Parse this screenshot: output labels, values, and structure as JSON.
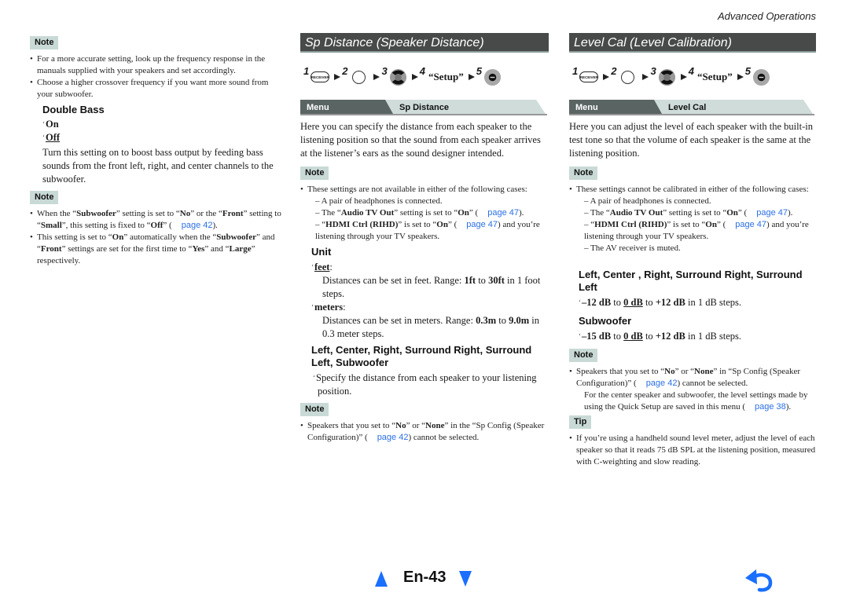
{
  "header": {
    "section": "Advanced Operations"
  },
  "col1": {
    "note1": {
      "label": "Note",
      "items": [
        "For a more accurate setting, look up the frequency response in the manuals supplied with your speakers and set accordingly.",
        "Choose a higher crossover frequency if you want more sound from your subwoofer."
      ]
    },
    "double_bass": {
      "heading": "Double Bass",
      "options": [
        "On",
        "Off"
      ],
      "default_option": "Off",
      "description": "Turn this setting on to boost bass output by feeding bass sounds from the front left, right, and center channels to the subwoofer."
    },
    "note2": {
      "label": "Note",
      "item1": {
        "p1": "When the “",
        "b1": "Subwoofer",
        "p2": "” setting is set to “",
        "b2": "No",
        "p3": "” or the “",
        "b3": "Front",
        "p4": "” setting to “",
        "b4": "Small",
        "p5": "”, this setting is fixed to “",
        "b5": "Off",
        "p6": "” (",
        "link": "page 42",
        "p7": ")."
      },
      "item2": {
        "p1": "This setting is set to “",
        "b1": "On",
        "p2": "” automatically when the “",
        "b2": "Subwoofer",
        "p3": "” and “",
        "b3": "Front",
        "p4": "” settings are set for the first time to “",
        "b4": "Yes",
        "p5": "” and “",
        "b5": "Large",
        "p6": "” respectively."
      }
    }
  },
  "col2": {
    "title": "Sp Distance (Speaker Distance)",
    "steps": {
      "n1": "1",
      "n2": "2",
      "n3": "3",
      "n4": "4",
      "n5": "5",
      "receiver_label": "RECEIVER",
      "setup": "“Setup”"
    },
    "menu": {
      "label": "Menu",
      "item": "Sp Distance"
    },
    "intro": "Here you can specify the distance from each speaker to the listening position so that the sound from each speaker arrives at the listener’s ears as the sound designer intended.",
    "note1": {
      "label": "Note",
      "lead": "These settings are not available in either of the following cases:",
      "sub1": "– A pair of headphones is connected.",
      "sub2": {
        "p1": "– The “",
        "b1": "Audio TV Out",
        "p2": "” setting is set to “",
        "b2": "On",
        "p3": "” (",
        "link": "page 47",
        "p4": ")."
      },
      "sub3": {
        "p1": "– “",
        "b1": "HDMI Ctrl (RIHD)",
        "p2": "” is set to “",
        "b2": "On",
        "p3": "” (",
        "link": "page 47",
        "p4": ") and you’re listening through your TV speakers."
      }
    },
    "unit": {
      "heading": "Unit",
      "feet_label": "feet",
      "feet_desc": {
        "p1": "Distances can be set in feet. Range: ",
        "b1": "1ft",
        "p2": " to ",
        "b2": "30ft",
        "p3": " in 1 foot steps."
      },
      "meters_label": "meters",
      "meters_desc": {
        "p1": "Distances can be set in meters. Range: ",
        "b1": "0.3m",
        "p2": " to ",
        "b2": "9.0m",
        "p3": " in 0.3 meter steps."
      }
    },
    "speakers": {
      "heading": "Left, Center, Right, Surround Right, Surround Left, Subwoofer",
      "desc": "Specify the distance from each speaker to your listening position."
    },
    "note2": {
      "label": "Note",
      "item": {
        "p1": "Speakers that you set to “",
        "b1": "No",
        "p2": "” or “",
        "b2": "None",
        "p3": "” in the “Sp Config (Speaker Configuration)” (",
        "link": "page 42",
        "p4": ") cannot be selected."
      }
    }
  },
  "col3": {
    "title": "Level Cal (Level Calibration)",
    "steps": {
      "n1": "1",
      "n2": "2",
      "n3": "3",
      "n4": "4",
      "n5": "5",
      "receiver_label": "RECEIVER",
      "setup": "“Setup”"
    },
    "menu": {
      "label": "Menu",
      "item": "Level Cal"
    },
    "intro": "Here you can adjust the level of each speaker with the built-in test tone so that the volume of each speaker is the same at the listening position.",
    "note1": {
      "label": "Note",
      "lead": "These settings cannot be calibrated in either of the following cases:",
      "sub1": "– A pair of headphones is connected.",
      "sub2": {
        "p1": "– The “",
        "b1": "Audio TV Out",
        "p2": "” setting is set to “",
        "b2": "On",
        "p3": "” (",
        "link": "page 47",
        "p4": ")."
      },
      "sub3": {
        "p1": "– “",
        "b1": "HDMI Ctrl (RIHD)",
        "p2": "” is set to “",
        "b2": "On",
        "p3": "” (",
        "link": "page 47",
        "p4": ") and you’re listening through your TV speakers."
      },
      "sub4": "– The AV receiver is muted."
    },
    "main_speakers": {
      "heading": "Left, Center   , Right, Surround Right, Surround Left",
      "range": {
        "min": "–12 dB",
        "p1": " to ",
        "default": "0 dB",
        "p2": " to ",
        "max": "+12 dB",
        "p3": " in 1 dB steps."
      }
    },
    "subwoofer": {
      "heading": "Subwoofer",
      "range": {
        "min": "–15 dB",
        "p1": " to ",
        "default": "0 dB",
        "p2": " to ",
        "max": "+12 dB",
        "p3": " in 1 dB steps."
      }
    },
    "note2": {
      "label": "Note",
      "item": {
        "p1": "Speakers that you set to “",
        "b1": "No",
        "p2": "” or “",
        "b2": "None",
        "p3": "” in “Sp Config (Speaker Configuration)” (",
        "link": "page 42",
        "p4": ") cannot be selected."
      },
      "cont": {
        "p1": "For the center speaker and subwoofer, the level settings made by using the Quick Setup are saved in this menu (",
        "link": "page 38",
        "p2": ")."
      }
    },
    "tip": {
      "label": "Tip",
      "item": "If you’re using a handheld sound level meter, adjust the level of each speaker so that it reads 75 dB SPL at the listening position, measured with C-weighting and slow reading."
    }
  },
  "footer": {
    "page_number": "En-43",
    "accent_color": "#1a6fff"
  }
}
